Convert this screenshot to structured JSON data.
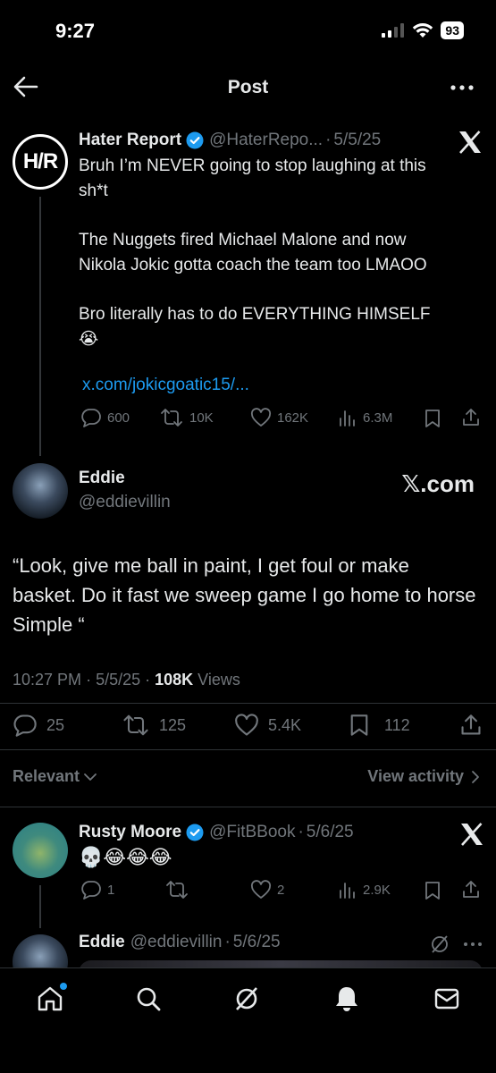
{
  "status_bar": {
    "time": "9:27",
    "battery": "93"
  },
  "header": {
    "title": "Post"
  },
  "quoted_post": {
    "name": "Hater Report",
    "handle": "@HaterRepo...",
    "date": "5/5/25",
    "avatar_text": "H/R",
    "lines": [
      "Bruh I’m NEVER going to stop laughing at this",
      "sh*t",
      "The Nuggets fired Michael Malone and now",
      "Nikola Jokic gotta coach the team too LMAOO",
      "Bro literally has to do EVERYTHING HIMSELF",
      "😭"
    ],
    "link": "x.com/jokicgoatic15/...",
    "replies": "600",
    "reposts": "10K",
    "likes": "162K",
    "views": "6.3M"
  },
  "main_post": {
    "name": "Eddie",
    "handle": "@eddievillin",
    "badge": "𝕏.com",
    "text": "“Look, give me ball in paint, I get foul or make basket. Do it fast we sweep game I go home to horse Simple “",
    "time": "10:27 PM",
    "date": "5/5/25",
    "views_count": "108K",
    "views_label": "Views",
    "replies": "25",
    "reposts": "125",
    "likes": "5.4K",
    "bookmarks": "112"
  },
  "sort": {
    "label": "Relevant",
    "view_activity": "View activity"
  },
  "replies": [
    {
      "name": "Rusty Moore",
      "handle": "@FitBBook",
      "date": "5/6/25",
      "text": "💀😂😂😂",
      "replies": "1",
      "reposts": "",
      "likes": "2",
      "views": "2.9K"
    },
    {
      "name": "Eddie",
      "handle": "@eddievillin",
      "date": "5/6/25"
    }
  ],
  "colors": {
    "background": "#000000",
    "accent": "#1d9bf0",
    "muted": "#71767b",
    "text": "#e7e9ea"
  }
}
